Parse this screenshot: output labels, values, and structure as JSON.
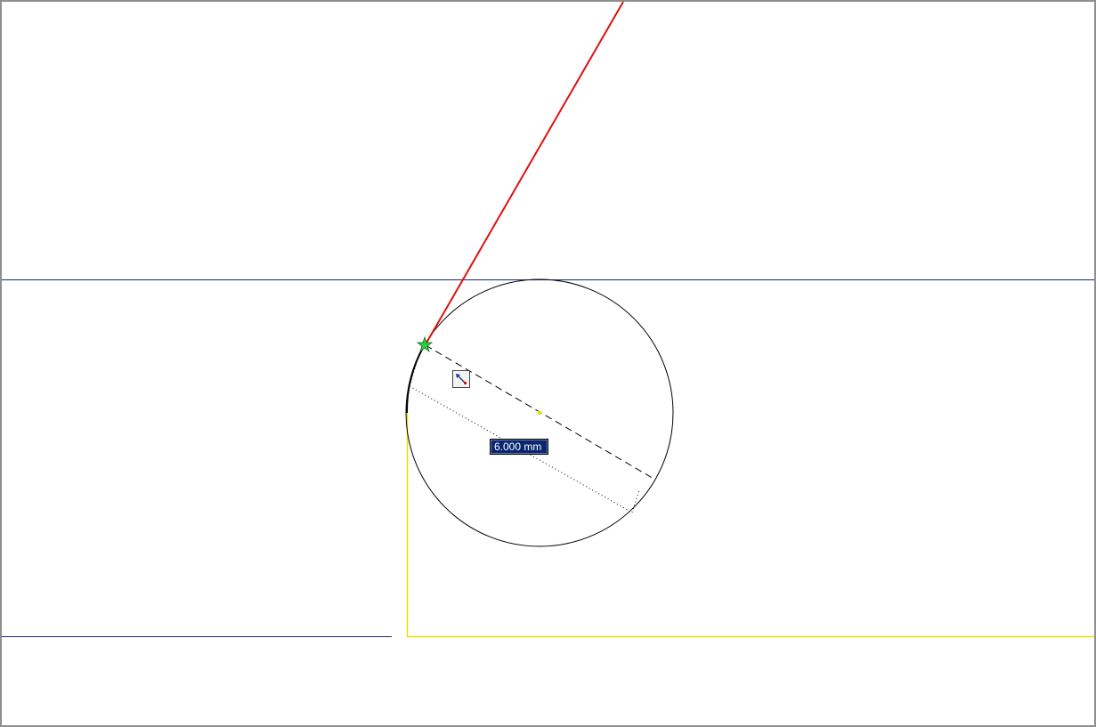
{
  "viewport": {
    "name": "sketch-graphics-window"
  },
  "colors": {
    "background": "#ffffff",
    "construction_line": "#1a237e",
    "selected_edge": "#e8e000",
    "preview_line": "#e01010",
    "circle": "#000000",
    "snap_point": "#2ecc40",
    "dimension_box_bg": "#0a2670",
    "dimension_box_text": "#ffffff"
  },
  "dimension_input": {
    "value": "6.000 mm"
  },
  "tool": {
    "cursor_icon": "diameter-tool-icon"
  }
}
